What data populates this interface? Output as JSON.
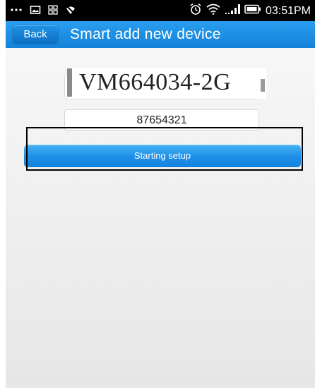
{
  "status_bar": {
    "left_icons": [
      "more-icon",
      "image-icon",
      "app-grid-icon",
      "signal-off-icon"
    ],
    "right_icons": [
      "alarm-icon",
      "wifi-icon",
      "cell-signal-icon",
      "battery-icon"
    ],
    "time": "03:51PM"
  },
  "header": {
    "back_label": "Back",
    "title": "Smart add new device"
  },
  "form": {
    "device_id": "VM664034-2G",
    "password": "87654321",
    "start_button_label": "Starting setup"
  },
  "colors": {
    "accent": "#1a8be3",
    "title_bar": "#1382d8",
    "status_bar": "#000000"
  }
}
